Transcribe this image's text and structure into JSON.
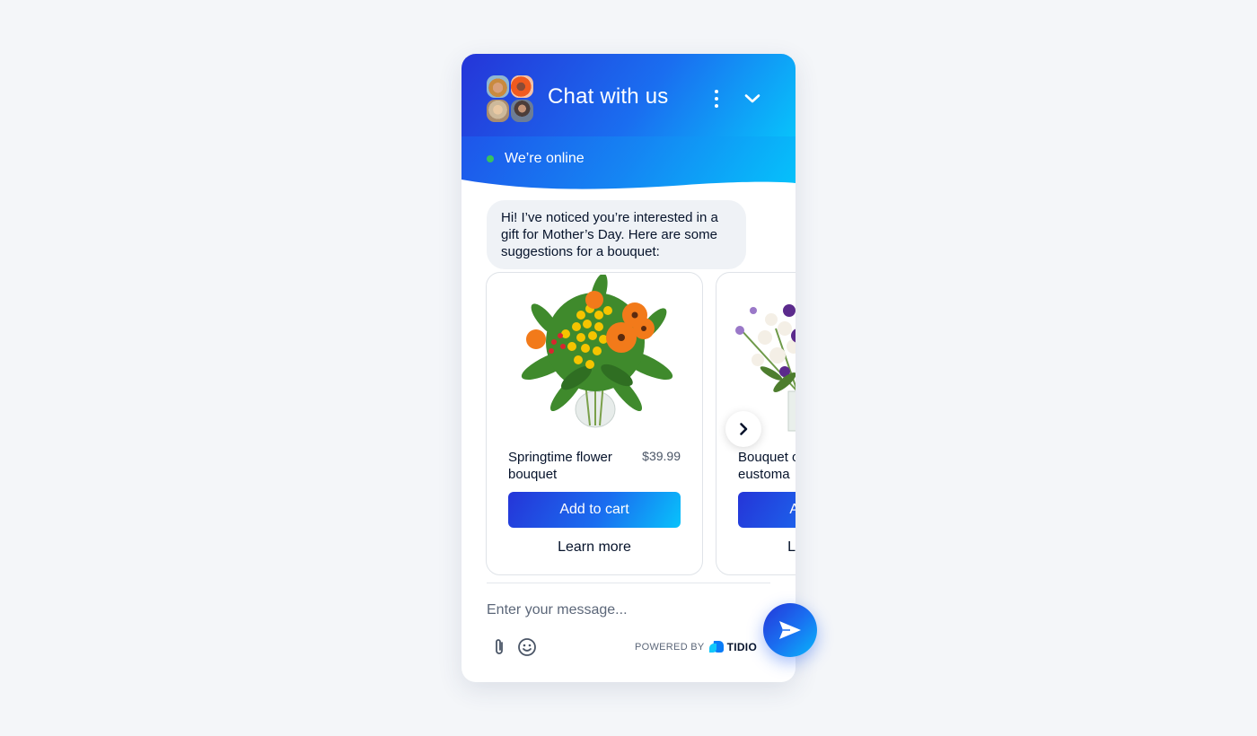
{
  "header": {
    "title": "Chat with us",
    "menu_icon": "more-vertical-icon",
    "minimize_icon": "chevron-down-icon",
    "status_text": "We’re online",
    "status_color": "#38c25d",
    "agents": [
      "agent-1",
      "agent-2",
      "agent-3",
      "agent-4"
    ]
  },
  "conversation": {
    "bot_message": "Hi! I’ve noticed you’re interested in a gift for Mother’s Day. Here are some suggestions for a bouquet:"
  },
  "products": [
    {
      "name": "Springtime flower bouquet",
      "price": "$39.99",
      "add_to_cart_label": "Add to cart",
      "learn_more_label": "Learn more"
    },
    {
      "name": "Bouquet of eustoma",
      "price": "",
      "add_to_cart_label": "Add to cart",
      "learn_more_label": "Learn more"
    }
  ],
  "carousel": {
    "next_icon": "chevron-right-icon"
  },
  "composer": {
    "placeholder": "Enter your message...",
    "value": "",
    "attach_icon": "paperclip-icon",
    "emoji_icon": "smiley-icon",
    "send_icon": "send-icon"
  },
  "branding": {
    "powered_by": "POWERED BY",
    "brand": "TIDIO"
  },
  "colors": {
    "gradient_start": "#2535d8",
    "gradient_end": "#08c2fb",
    "text_dark": "#06132b"
  }
}
